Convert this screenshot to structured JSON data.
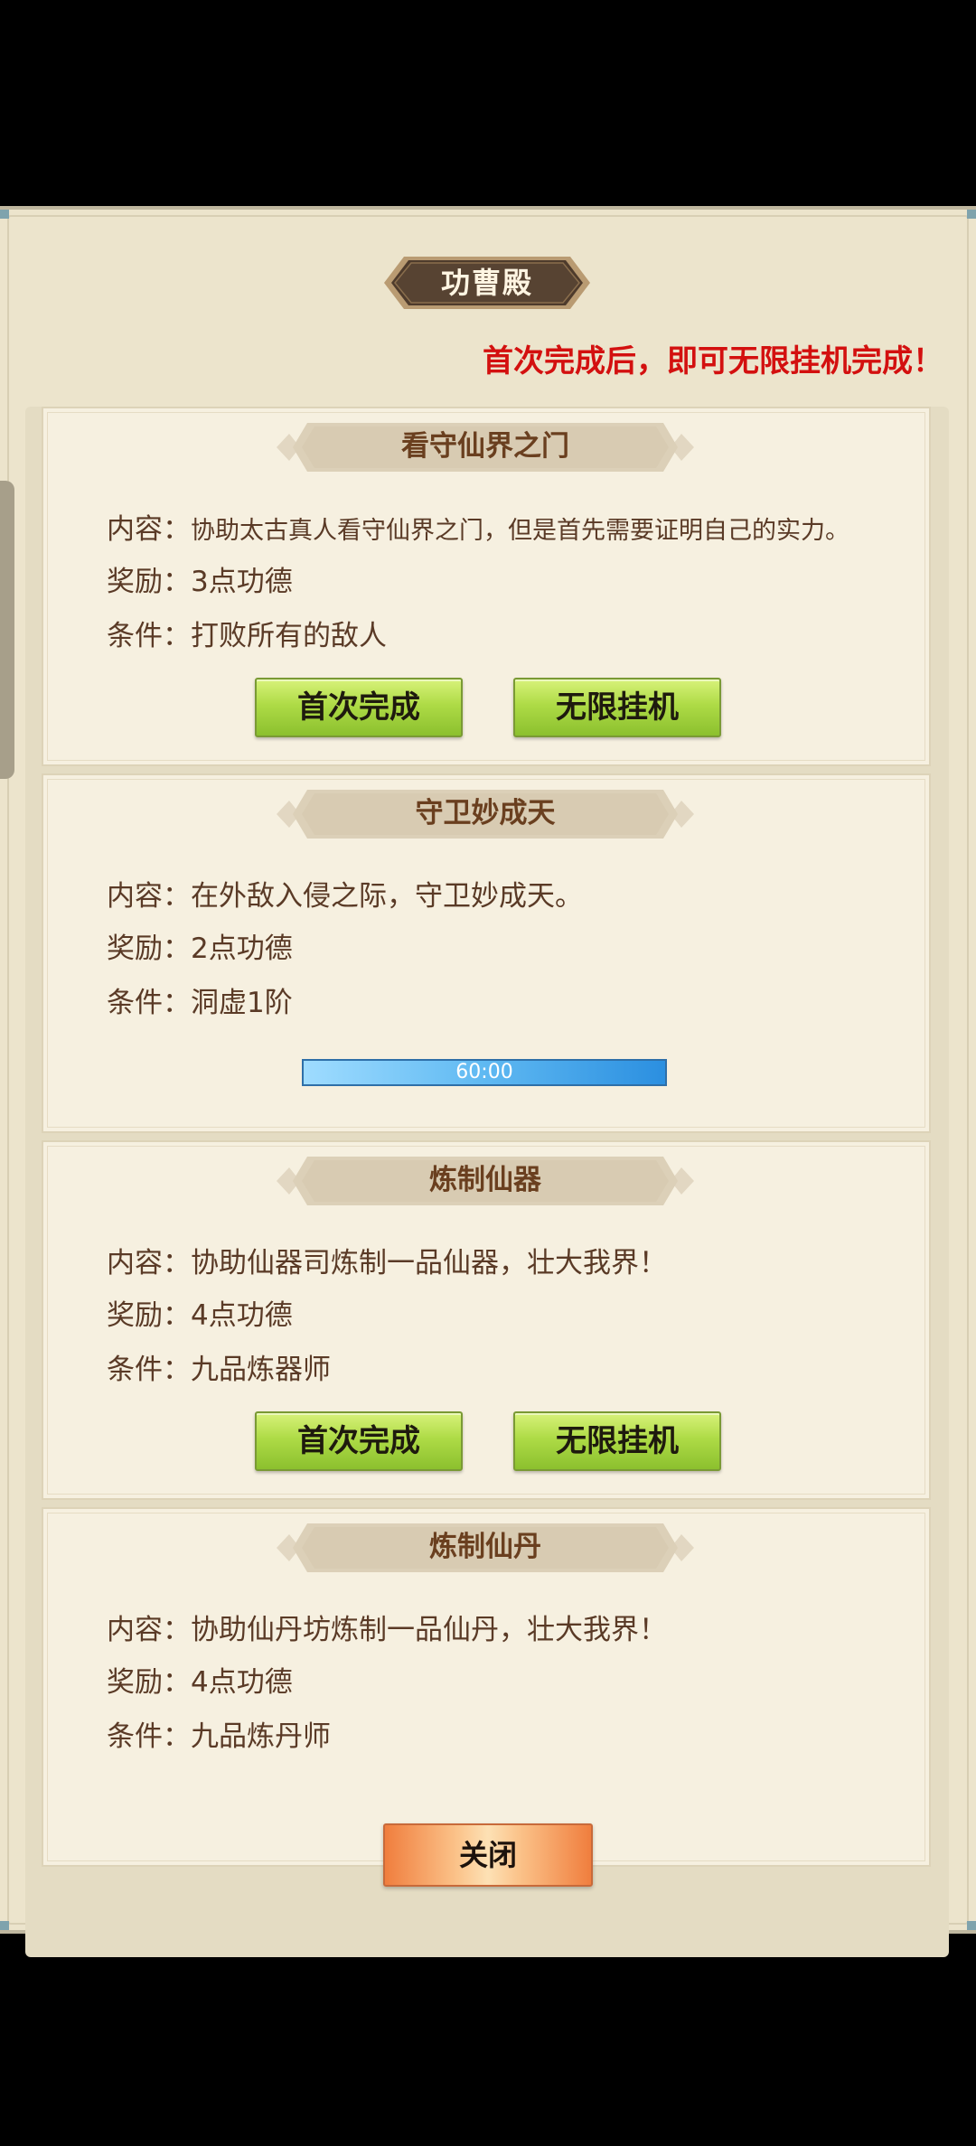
{
  "title": "功曹殿",
  "notice": "首次完成后，即可无限挂机完成！",
  "labels": {
    "content": "内容：",
    "reward": "奖励：",
    "condition": "条件："
  },
  "tasks": [
    {
      "title": "看守仙界之门",
      "content": "协助太古真人看守仙界之门，但是首先需要证明自己的实力。",
      "reward": "3点功德",
      "condition": "打败所有的敌人",
      "first_button": "首次完成",
      "idle_button": "无限挂机"
    },
    {
      "title": "守卫妙成天",
      "content": "在外敌入侵之际，守卫妙成天。",
      "reward": "2点功德",
      "condition": "洞虚1阶",
      "timer": "60:00",
      "progress": 1.0
    },
    {
      "title": "炼制仙器",
      "content": "协助仙器司炼制一品仙器，壮大我界！",
      "reward": "4点功德",
      "condition": "九品炼器师",
      "first_button": "首次完成",
      "idle_button": "无限挂机"
    },
    {
      "title": "炼制仙丹",
      "content": "协助仙丹坊炼制一品仙丹，壮大我界！",
      "reward": "4点功德",
      "condition": "九品炼丹师"
    }
  ],
  "close_button": "关闭",
  "colors": {
    "accent_green": "#aedb46",
    "notice_red": "#d3100f",
    "close_orange": "#f07e3e",
    "progress_blue": "#2b8fe0"
  }
}
